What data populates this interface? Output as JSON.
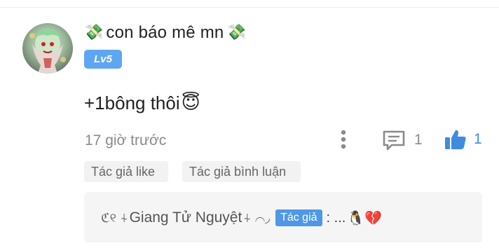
{
  "comment": {
    "username": "con báo mê mn",
    "username_emoji": "💸",
    "level": "Lv5",
    "text": "+1bông thôi",
    "text_emoji": "😇",
    "timestamp": "17 giờ trước",
    "reply_count": "1",
    "like_count": "1"
  },
  "tags": [
    {
      "label": "Tác giả like"
    },
    {
      "label": "Tác giả bình luận"
    }
  ],
  "reply": {
    "deco_left": "ℭ୧ ⍭",
    "author": "Giang Tử Nguyệt",
    "deco_right": "⍭ ⌒◞",
    "author_tag": "Tác giả",
    "text": ": ...",
    "emoji": "🐧💔"
  },
  "icons": {
    "more": "more-vertical-icon",
    "reply": "comment-bubble-icon",
    "like": "thumbs-up-icon"
  },
  "colors": {
    "accent": "#5ea6f2",
    "like": "#3f8be0",
    "muted": "#8a8a8a"
  }
}
